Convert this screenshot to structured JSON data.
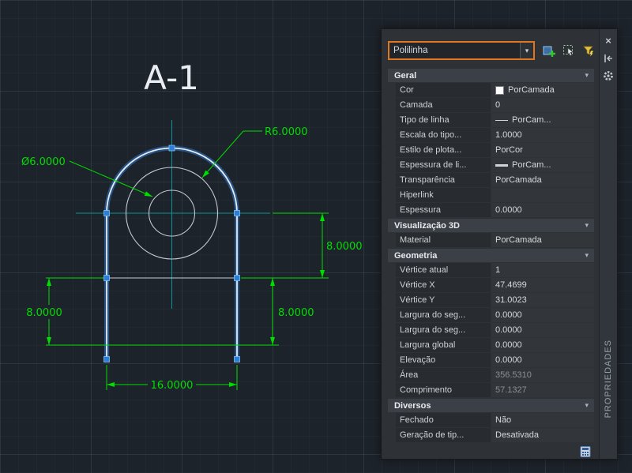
{
  "canvas": {
    "title": "A-1",
    "dims": {
      "right": "8.0000",
      "mid": "8.0000",
      "left": "8.0000",
      "bottom": "16.0000"
    },
    "labels": {
      "radius": "R6.0000",
      "diameter": "Ø6.0000"
    },
    "colors": {
      "dimension": "#00dd00",
      "crosshair": "#0e9494",
      "glow": "#2f7fd6",
      "grip": "#2a7fd9"
    }
  },
  "panel": {
    "title": "PROPRIEDADES",
    "accent": "#e0761f",
    "selector_value": "Polilinha",
    "toolbar": {
      "pickadd": "pickadd-toggle",
      "select": "select-objects",
      "quick_select": "quick-select"
    },
    "sections": [
      {
        "label": "Geral",
        "rows": [
          {
            "label": "Cor",
            "value": "PorCamada",
            "swatch": "#ffffff"
          },
          {
            "label": "Camada",
            "value": "0"
          },
          {
            "label": "Tipo de linha",
            "value": "PorCam...",
            "preview": "linetype"
          },
          {
            "label": "Escala do tipo...",
            "value": "1.0000"
          },
          {
            "label": "Estilo de plota...",
            "value": "PorCor"
          },
          {
            "label": "Espessura de li...",
            "value": "PorCam...",
            "preview": "lineweight"
          },
          {
            "label": "Transparência",
            "value": "PorCamada"
          },
          {
            "label": "Hiperlink",
            "value": ""
          },
          {
            "label": "Espessura",
            "value": "0.0000"
          }
        ]
      },
      {
        "label": "Visualização 3D",
        "rows": [
          {
            "label": "Material",
            "value": "PorCamada"
          }
        ]
      },
      {
        "label": "Geometria",
        "rows": [
          {
            "label": "Vértice atual",
            "value": "1"
          },
          {
            "label": "Vértice X",
            "value": "47.4699"
          },
          {
            "label": "Vértice Y",
            "value": "31.0023"
          },
          {
            "label": "Largura do seg...",
            "value": "0.0000"
          },
          {
            "label": "Largura do seg...",
            "value": "0.0000"
          },
          {
            "label": "Largura global",
            "value": "0.0000"
          },
          {
            "label": "Elevação",
            "value": "0.0000"
          },
          {
            "label": "Área",
            "value": "356.5310",
            "muted": true
          },
          {
            "label": "Comprimento",
            "value": "57.1327",
            "muted": true
          }
        ]
      },
      {
        "label": "Diversos",
        "rows": [
          {
            "label": "Fechado",
            "value": "Não"
          },
          {
            "label": "Geração de tip...",
            "value": "Desativada"
          }
        ]
      }
    ]
  }
}
